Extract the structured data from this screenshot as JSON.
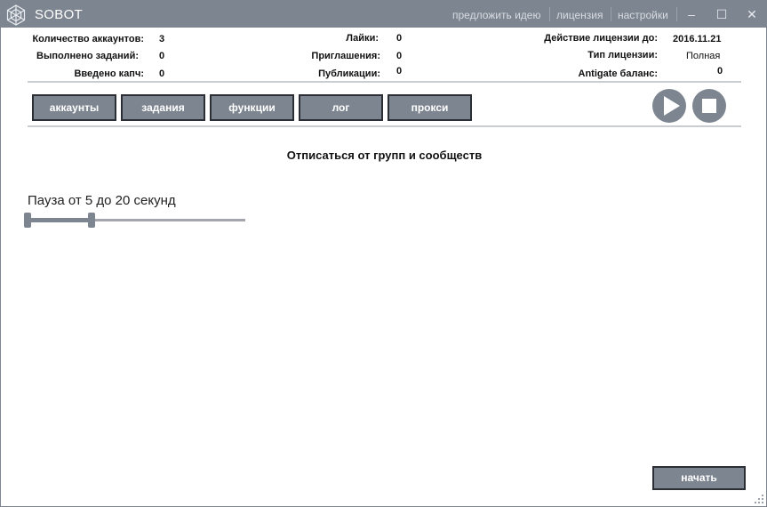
{
  "titlebar": {
    "app_name": "SOBOT",
    "links": [
      "предложить идею",
      "лицензия",
      "настройки"
    ],
    "minimize": "‒",
    "maximize": "☐",
    "close": "✕"
  },
  "stats": {
    "accounts_label": "Количество аккаунтов:",
    "accounts_value": "3",
    "tasks_label": "Выполнено заданий:",
    "tasks_value": "0",
    "captcha_label": "Введено капч:",
    "captcha_value": "0",
    "likes_label": "Лайки:",
    "likes_value": "0",
    "invites_label": "Приглашения:",
    "invites_value": "0",
    "posts_label": "Публикации:",
    "posts_value": "0",
    "license_until_label": "Действие лицензии до:",
    "license_until_value": "2016.11.21",
    "license_type_label": "Тип лицензии:",
    "license_type_value": "Полная",
    "antigate_label": "Antigate баланс:",
    "antigate_value": "0"
  },
  "tabs": [
    "аккаунты",
    "задания",
    "функции",
    "лог",
    "прокси"
  ],
  "main": {
    "heading": "Отписаться от групп и сообществ",
    "pause_label": "Пауза от 5 до 20 секунд",
    "pause_min": 5,
    "pause_max": 20,
    "start_label": "начать"
  },
  "colors": {
    "accent": "#7d8590",
    "border_dark": "#2b2f35",
    "titlebar_text": "#ffffff"
  }
}
